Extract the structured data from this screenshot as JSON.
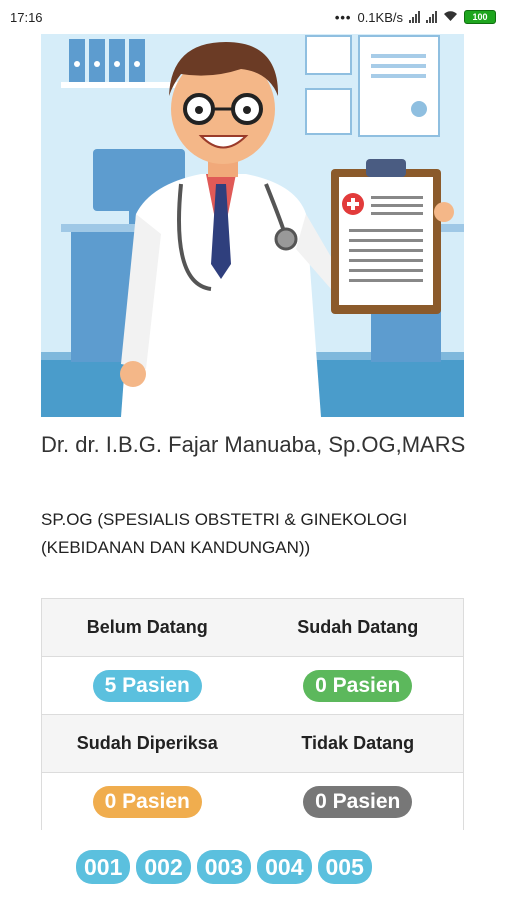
{
  "status_bar": {
    "time": "17:16",
    "network_speed": "0.1KB/s",
    "battery_level": "100",
    "icons": [
      "more-dots-icon",
      "signal-icon",
      "signal-icon",
      "wifi-icon",
      "battery-icon"
    ]
  },
  "doctor": {
    "name": "Dr. dr. I.B.G. Fajar Manuaba, Sp.OG,MARS",
    "specialty": "SP.OG (SPESIALIS OBSTETRI & GINEKOLOGI (KEBIDANAN DAN KANDUNGAN))"
  },
  "stats": {
    "belum_datang": {
      "label": "Belum Datang",
      "value": "5 Pasien",
      "color": "#5bc0de"
    },
    "sudah_datang": {
      "label": "Sudah Datang",
      "value": "0 Pasien",
      "color": "#5cb85c"
    },
    "sudah_diperiksa": {
      "label": "Sudah Diperiksa",
      "value": "0 Pasien",
      "color": "#f0ad4e"
    },
    "tidak_datang": {
      "label": "Tidak Datang",
      "value": "0 Pasien",
      "color": "#777777"
    }
  },
  "queue_numbers": [
    "001",
    "002",
    "003",
    "004",
    "005"
  ],
  "colors": {
    "accent": "#5bc0de"
  }
}
